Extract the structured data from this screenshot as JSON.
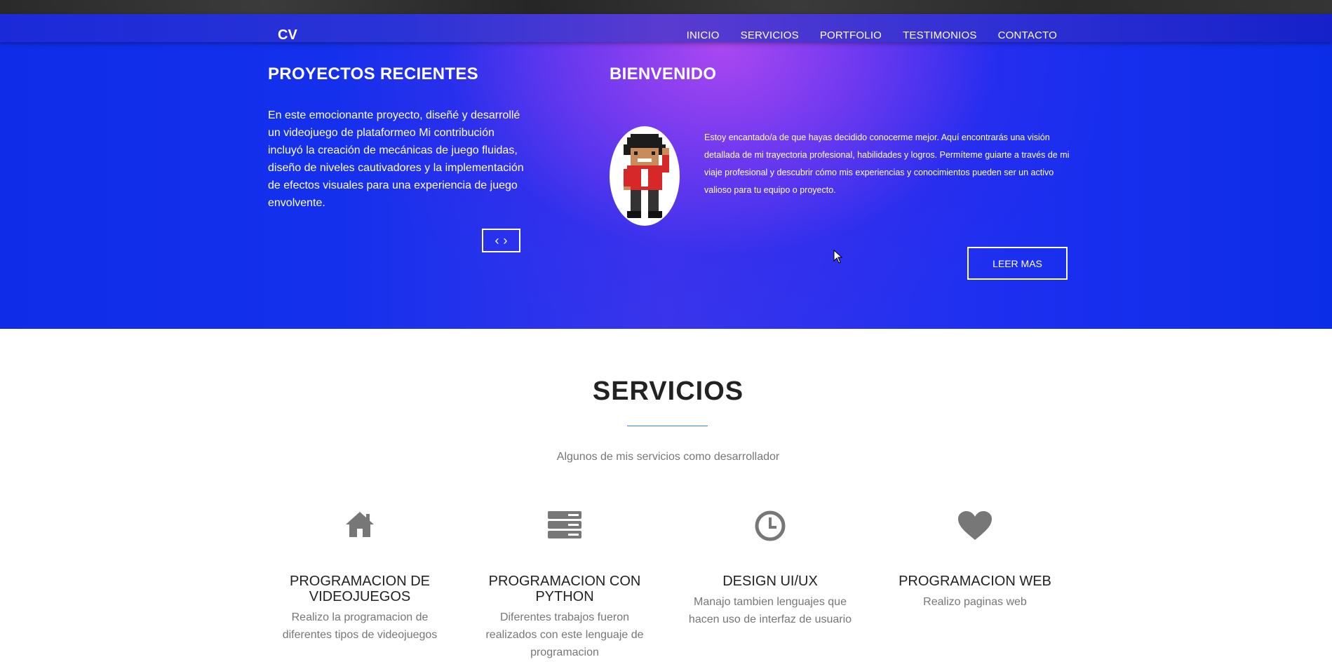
{
  "nav": {
    "brand": "CV",
    "items": [
      "INICIO",
      "SERVICIOS",
      "PORTFOLIO",
      "TESTIMONIOS",
      "CONTACTO"
    ]
  },
  "hero": {
    "left_title": "PROYECTOS RECIENTES",
    "left_text": "En este emocionante proyecto, diseñé y desarrollé un videojuego de plataformeo Mi contribución incluyó la creación de mecánicas de juego fluidas, diseño de niveles cautivadores y la implementación de efectos visuales para una experiencia de juego envolvente.",
    "carousel_prev": "‹",
    "carousel_next": "›",
    "right_title": "BIENVENIDO",
    "right_text": "Estoy encantado/a de que hayas decidido conocerme mejor. Aquí encontrarás una visión detallada de mi trayectoria profesional, habilidades y logros. Permíteme guiarte a través de mi viaje profesional y descubrir cómo mis experiencias y conocimientos pueden ser un activo valioso para tu equipo o proyecto.",
    "read_more": "LEER MAS"
  },
  "services": {
    "title": "SERVICIOS",
    "subtitle": "Algunos de mis servicios como desarrollador",
    "items": [
      {
        "icon": "home-icon",
        "title": "PROGRAMACION DE VIDEOJUEGOS",
        "text": "Realizo la programacion de diferentes tipos de videojuegos"
      },
      {
        "icon": "server-icon",
        "title": "PROGRAMACION CON PYTHON",
        "text": "Diferentes trabajos fueron realizados con este lenguaje de programacion"
      },
      {
        "icon": "clock-icon",
        "title": "DESIGN UI/UX",
        "text": "Manajo tambien lenguajes que hacen uso de interfaz de usuario"
      },
      {
        "icon": "heart-icon",
        "title": "PROGRAMACION WEB",
        "text": "Realizo paginas web"
      }
    ]
  },
  "colors": {
    "hero_blue": "#1430ec",
    "hero_purple": "#b048f0",
    "accent_line": "#2e86de",
    "icon_gray": "#777777"
  }
}
